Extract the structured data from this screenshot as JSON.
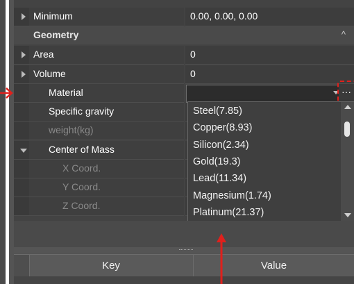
{
  "properties": {
    "rows": [
      {
        "label": "Minimum",
        "value": "0.00, 0.00, 0.00"
      },
      {
        "label": "Area",
        "value": "0"
      },
      {
        "label": "Volume",
        "value": "0"
      },
      {
        "label": "Material",
        "value": ""
      },
      {
        "label": "Specific gravity",
        "value": ""
      },
      {
        "label": "weight(kg)",
        "value": ""
      },
      {
        "label": "Center of Mass",
        "value": ""
      },
      {
        "label": "X Coord.",
        "value": ""
      },
      {
        "label": "Y Coord.",
        "value": ""
      },
      {
        "label": "Z Coord.",
        "value": ""
      }
    ],
    "section_geometry": "Geometry",
    "section_caret": "^",
    "material_browse": "···"
  },
  "material_dropdown": {
    "options": [
      "Steel(7.85)",
      "Copper(8.93)",
      "Silicon(2.34)",
      "Gold(19.3)",
      "Lead(11.34)",
      "Magnesium(1.74)",
      "Platinum(21.37)"
    ]
  },
  "key_value_table": {
    "headers": [
      "Key",
      "Value"
    ]
  },
  "annotation_color": "#e0201c"
}
